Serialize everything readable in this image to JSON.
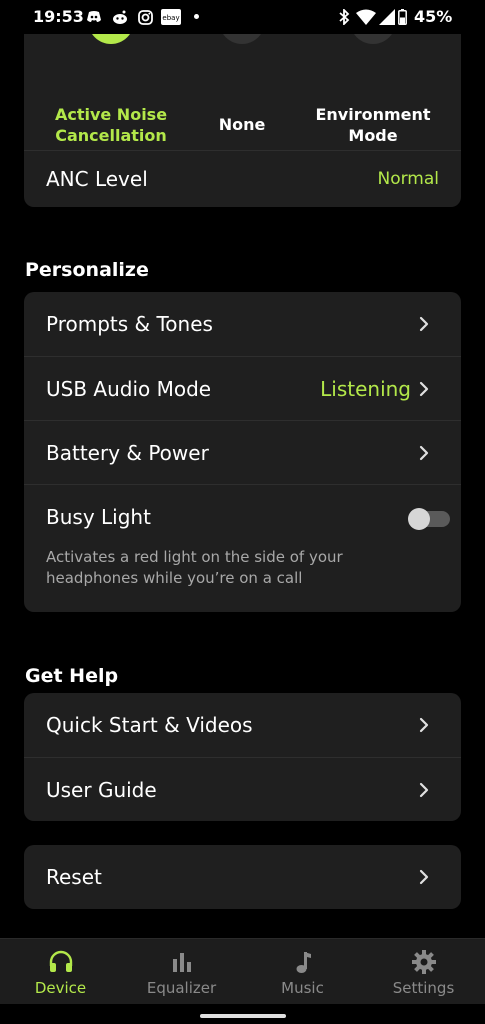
{
  "status_bar": {
    "time": "19:53",
    "battery": "45%",
    "icons": [
      "discord-icon",
      "reddit-icon",
      "instagram-icon",
      "ebay-icon",
      "bluetooth-icon",
      "wifi-icon",
      "signal-icon",
      "battery-icon"
    ]
  },
  "noise_modes": {
    "modes": [
      {
        "label": "Active Noise Cancellation",
        "selected": true
      },
      {
        "label": "None",
        "selected": false
      },
      {
        "label": "Environment Mode",
        "selected": false
      }
    ],
    "anc_level_label": "ANC Level",
    "anc_level_value": "Normal"
  },
  "personalize": {
    "title": "Personalize",
    "prompts_label": "Prompts & Tones",
    "usb_label": "USB Audio Mode",
    "usb_value": "Listening",
    "battery_label": "Battery & Power",
    "busy_label": "Busy Light",
    "busy_enabled": false,
    "busy_description": "Activates a red light on the side of your headphones while you’re on a call"
  },
  "help": {
    "title": "Get Help",
    "quick_start_label": "Quick Start & Videos",
    "user_guide_label": "User Guide"
  },
  "reset": {
    "label": "Reset"
  },
  "bottom_nav": {
    "items": [
      {
        "label": "Device",
        "icon": "headphones-icon",
        "active": true
      },
      {
        "label": "Equalizer",
        "icon": "equalizer-icon",
        "active": false
      },
      {
        "label": "Music",
        "icon": "music-note-icon",
        "active": false
      },
      {
        "label": "Settings",
        "icon": "gear-icon",
        "active": false
      }
    ]
  },
  "colors": {
    "accent": "#b3e84a",
    "background": "#000000",
    "card": "#1f1f1f",
    "secondary_text": "#a8a8a8"
  }
}
